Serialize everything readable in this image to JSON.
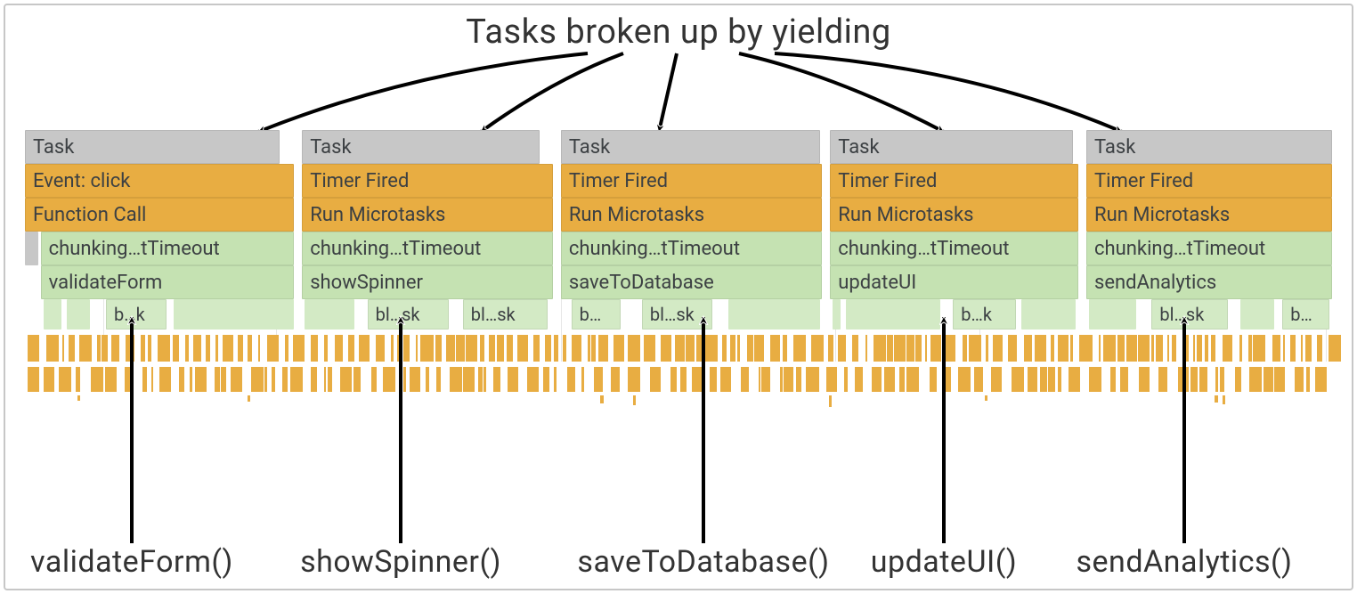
{
  "title": "Tasks broken up by yielding",
  "columns": [
    {
      "task": "Task",
      "row2": "Event: click",
      "row3": "Function Call",
      "row4": "chunking…tTimeout",
      "row5": "validateForm",
      "fn": "validateForm()"
    },
    {
      "task": "Task",
      "row2": "Timer Fired",
      "row3": "Run Microtasks",
      "row4": "chunking…tTimeout",
      "row5": "showSpinner",
      "fn": "showSpinner()"
    },
    {
      "task": "Task",
      "row2": "Timer Fired",
      "row3": "Run Microtasks",
      "row4": "chunking…tTimeout",
      "row5": "saveToDatabase",
      "fn": "saveToDatabase()"
    },
    {
      "task": "Task",
      "row2": "Timer Fired",
      "row3": "Run Microtasks",
      "row4": "chunking…tTimeout",
      "row5": "updateUI",
      "fn": "updateUI()"
    },
    {
      "task": "Task",
      "row2": "Timer Fired",
      "row3": "Run Microtasks",
      "row4": "chunking…tTimeout",
      "row5": "sendAnalytics",
      "fn": "sendAnalytics()"
    }
  ],
  "sub_labels": {
    "bk": "b…k",
    "blsk": "bl…sk",
    "b": "b…"
  },
  "colors": {
    "task_gray": "#c7c7c7",
    "event_amber": "#e8ad42",
    "call_green": "#c5e2b2"
  }
}
